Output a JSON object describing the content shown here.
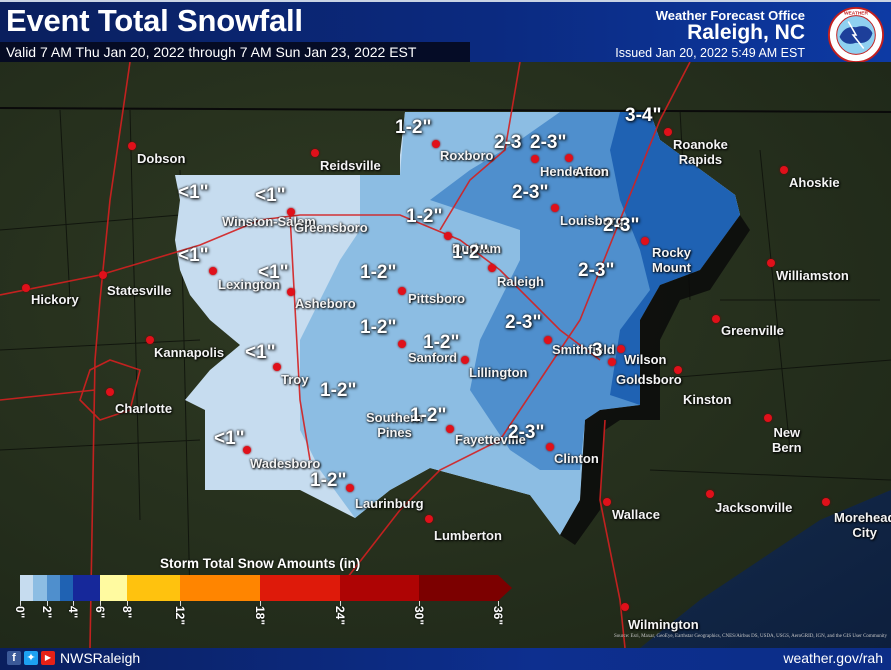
{
  "header": {
    "title": "Event Total Snowfall",
    "valid": "Valid 7 AM Thu Jan 20, 2022 through 7 AM Sun Jan 23, 2022 EST",
    "office_label": "Weather Forecast Office",
    "office_city": "Raleigh, NC",
    "issued": "Issued Jan 20, 2022 5:49 AM EST",
    "logo_icon": "nws-logo-icon"
  },
  "cities": [
    {
      "name": "Dobson"
    },
    {
      "name": "Reidsville"
    },
    {
      "name": "Roxboro"
    },
    {
      "name": "Henderson"
    },
    {
      "name": "Afton"
    },
    {
      "name": "Roanoke Rapids",
      "line1": "Roanoke",
      "line2": "Rapids"
    },
    {
      "name": "Ahoskie"
    },
    {
      "name": "Winston-Salem"
    },
    {
      "name": "Greensboro"
    },
    {
      "name": "Durham"
    },
    {
      "name": "Louisburg"
    },
    {
      "name": "Rocky Mount",
      "line1": "Rocky",
      "line2": "Mount"
    },
    {
      "name": "Williamston"
    },
    {
      "name": "Hickory"
    },
    {
      "name": "Statesville"
    },
    {
      "name": "Lexington"
    },
    {
      "name": "Asheboro"
    },
    {
      "name": "Pittsboro"
    },
    {
      "name": "Raleigh"
    },
    {
      "name": "Wilson"
    },
    {
      "name": "Greenville"
    },
    {
      "name": "Kannapolis"
    },
    {
      "name": "Troy"
    },
    {
      "name": "Sanford"
    },
    {
      "name": "Lillington"
    },
    {
      "name": "Smithfield"
    },
    {
      "name": "Goldsboro"
    },
    {
      "name": "Charlotte"
    },
    {
      "name": "Kinston"
    },
    {
      "name": "Southern Pines",
      "line1": "Southern",
      "line2": "Pines"
    },
    {
      "name": "Fayetteville"
    },
    {
      "name": "Clinton"
    },
    {
      "name": "New Bern",
      "line1": "New",
      "line2": "Bern"
    },
    {
      "name": "Wadesboro"
    },
    {
      "name": "Laurinburg"
    },
    {
      "name": "Lumberton"
    },
    {
      "name": "Wallace"
    },
    {
      "name": "Jacksonville"
    },
    {
      "name": "Morehead City",
      "line1": "Morehead",
      "line2": "City"
    },
    {
      "name": "Wilmington"
    }
  ],
  "amounts": [
    {
      "loc": "Roxboro",
      "text": "1-2\""
    },
    {
      "loc": "Henderson",
      "text": "2-3"
    },
    {
      "loc": "Afton",
      "text": "2-3\""
    },
    {
      "loc": "Roanoke Rapids",
      "text": "3-4\""
    },
    {
      "loc": "Louisburg",
      "text": "2-3\""
    },
    {
      "loc": "Rocky Mount",
      "text": "2-3\""
    },
    {
      "loc": "Winston-Salem west",
      "text": "<1\""
    },
    {
      "loc": "Winston-Salem",
      "text": "<1\""
    },
    {
      "loc": "Durham",
      "text": "1-2\""
    },
    {
      "loc": "Raleigh",
      "text": "1-2\""
    },
    {
      "loc": "Lexington west",
      "text": "<1\""
    },
    {
      "loc": "Asheboro",
      "text": "<1\""
    },
    {
      "loc": "Pittsboro",
      "text": "1-2\""
    },
    {
      "loc": "Wilson",
      "text": "2-3\""
    },
    {
      "loc": "Sanford",
      "text": "1-2\""
    },
    {
      "loc": "Lillington",
      "text": "1-2\""
    },
    {
      "loc": "Smithfield",
      "text": "2-3\""
    },
    {
      "loc": "Goldsboro",
      "text": "3"
    },
    {
      "loc": "Troy",
      "text": "<1\""
    },
    {
      "loc": "Southern Pines west",
      "text": "1-2\""
    },
    {
      "loc": "Fayetteville",
      "text": "1-2\""
    },
    {
      "loc": "Clinton",
      "text": "2-3\""
    },
    {
      "loc": "Wadesboro",
      "text": "<1\""
    },
    {
      "loc": "Laurinburg",
      "text": "1-2\""
    }
  ],
  "legend": {
    "title": "Storm Total Snow Amounts (in)",
    "bins": [
      {
        "from": 0,
        "to": 1,
        "color": "#c6dcef"
      },
      {
        "from": 1,
        "to": 2,
        "color": "#8cbde3"
      },
      {
        "from": 2,
        "to": 3,
        "color": "#4f8fcd"
      },
      {
        "from": 3,
        "to": 4,
        "color": "#1f62b3"
      },
      {
        "from": 4,
        "to": 6,
        "color": "#16289a"
      },
      {
        "from": 6,
        "to": 8,
        "color": "#fffaa0"
      },
      {
        "from": 8,
        "to": 12,
        "color": "#ffc20e"
      },
      {
        "from": 12,
        "to": 18,
        "color": "#ff8500"
      },
      {
        "from": 18,
        "to": 24,
        "color": "#de1a0a"
      },
      {
        "from": 24,
        "to": 30,
        "color": "#ae0404"
      },
      {
        "from": 30,
        "to": 36,
        "color": "#7c0000"
      }
    ],
    "ticks": [
      "0\"",
      "2\"",
      "4\"",
      "6\"",
      "8\"",
      "12\"",
      "18\"",
      "24\"",
      "30\"",
      "36\""
    ]
  },
  "attribution": "Source: Esri, Maxar, GeoEye, Earthstar Geographics, CNES/Airbus DS, USDA, USGS, AeroGRID, IGN, and the GIS User Community",
  "footer": {
    "social_icons": [
      "facebook-icon",
      "twitter-icon",
      "youtube-icon"
    ],
    "handle": "NWSRaleigh",
    "website": "weather.gov/rah"
  }
}
